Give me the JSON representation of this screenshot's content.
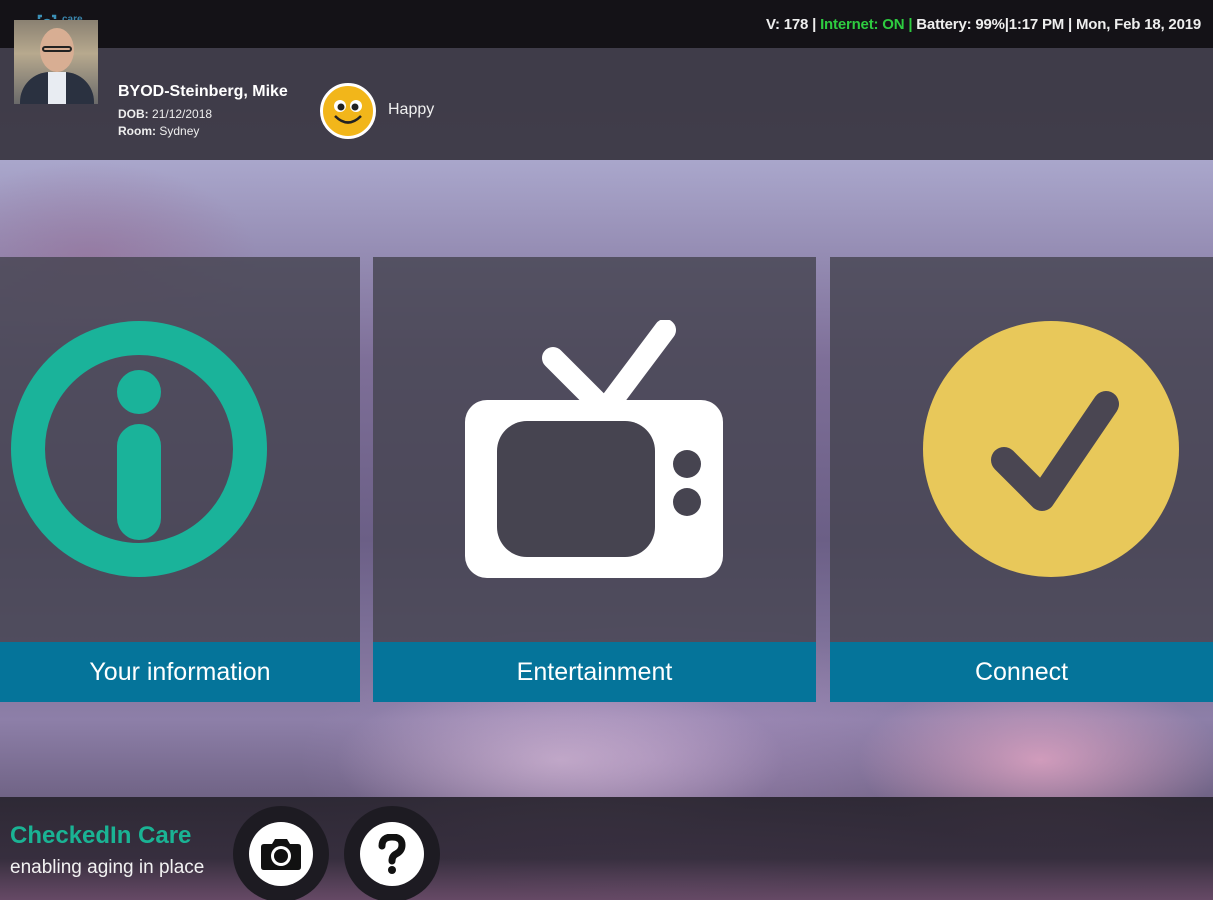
{
  "app": {
    "logo_text_line1": "care",
    "logo_text_line2": "cohort"
  },
  "status_bar": {
    "version": "V: 178 |",
    "internet": "Internet: ON |",
    "battery": "Battery: 99%",
    "time": "|1:17 PM",
    "date": "| Mon, Feb 18, 2019",
    "internet_color": "#2ecc40"
  },
  "resident": {
    "name": "BYOD-Steinberg, Mike",
    "dob_label": "DOB:",
    "dob": "21/12/2018",
    "room_label": "Room:",
    "room": "Sydney",
    "mood": "Happy",
    "mood_icon": "smiley-face-icon"
  },
  "tiles": [
    {
      "label": "Your information",
      "icon": "info-icon",
      "color": "#1ab39a"
    },
    {
      "label": "Entertainment",
      "icon": "tv-icon",
      "color": "#ffffff"
    },
    {
      "label": "Connect",
      "icon": "checkmark-icon",
      "color": "#e8c85a"
    }
  ],
  "footer": {
    "brand": "CheckedIn Care",
    "tagline": "enabling aging in place",
    "camera_icon": "camera-icon",
    "help_icon": "help-icon"
  },
  "colors": {
    "tile_label_bg": "#05749a",
    "topbar_bg": "#141217",
    "brand_green": "#1ab394"
  }
}
